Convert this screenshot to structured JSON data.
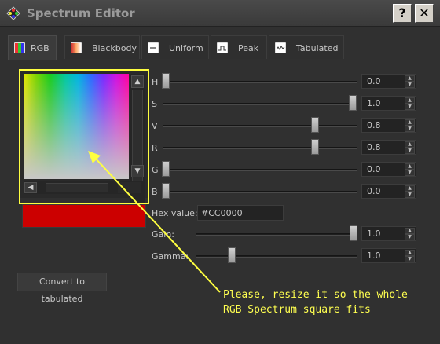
{
  "window": {
    "title": "Spectrum Editor",
    "help_label": "?",
    "close_label": "✕"
  },
  "tabs": [
    {
      "label": "RGB",
      "icon": "rgb-icon",
      "active": true
    },
    {
      "label": "Blackbody",
      "icon": "blackbody-icon",
      "active": false
    },
    {
      "label": "Uniform",
      "icon": "uniform-icon",
      "active": false
    },
    {
      "label": "Peak",
      "icon": "peak-icon",
      "active": false
    },
    {
      "label": "Tabulated",
      "icon": "tabulated-icon",
      "active": false
    }
  ],
  "sliders": [
    {
      "label": "H",
      "value": "0.0",
      "level": 0.0
    },
    {
      "label": "S",
      "value": "1.0",
      "level": 1.0
    },
    {
      "label": "V",
      "value": "0.8",
      "level": 0.8
    },
    {
      "label": "R",
      "value": "0.8",
      "level": 0.8
    },
    {
      "label": "G",
      "value": "0.0",
      "level": 0.0
    },
    {
      "label": "B",
      "value": "0.0",
      "level": 0.0
    }
  ],
  "hex": {
    "label": "Hex value:",
    "value": "#CC0000"
  },
  "gain": {
    "label": "Gain:",
    "value": "1.0"
  },
  "gamma": {
    "label": "Gamma:",
    "value": "1.0"
  },
  "swatch_color": "#cc0000",
  "convert_label": "Convert to tabulated",
  "annotation": {
    "line1": "Please, resize it so the whole",
    "line2": "RGB Spectrum square fits",
    "color": "#ffff40"
  }
}
